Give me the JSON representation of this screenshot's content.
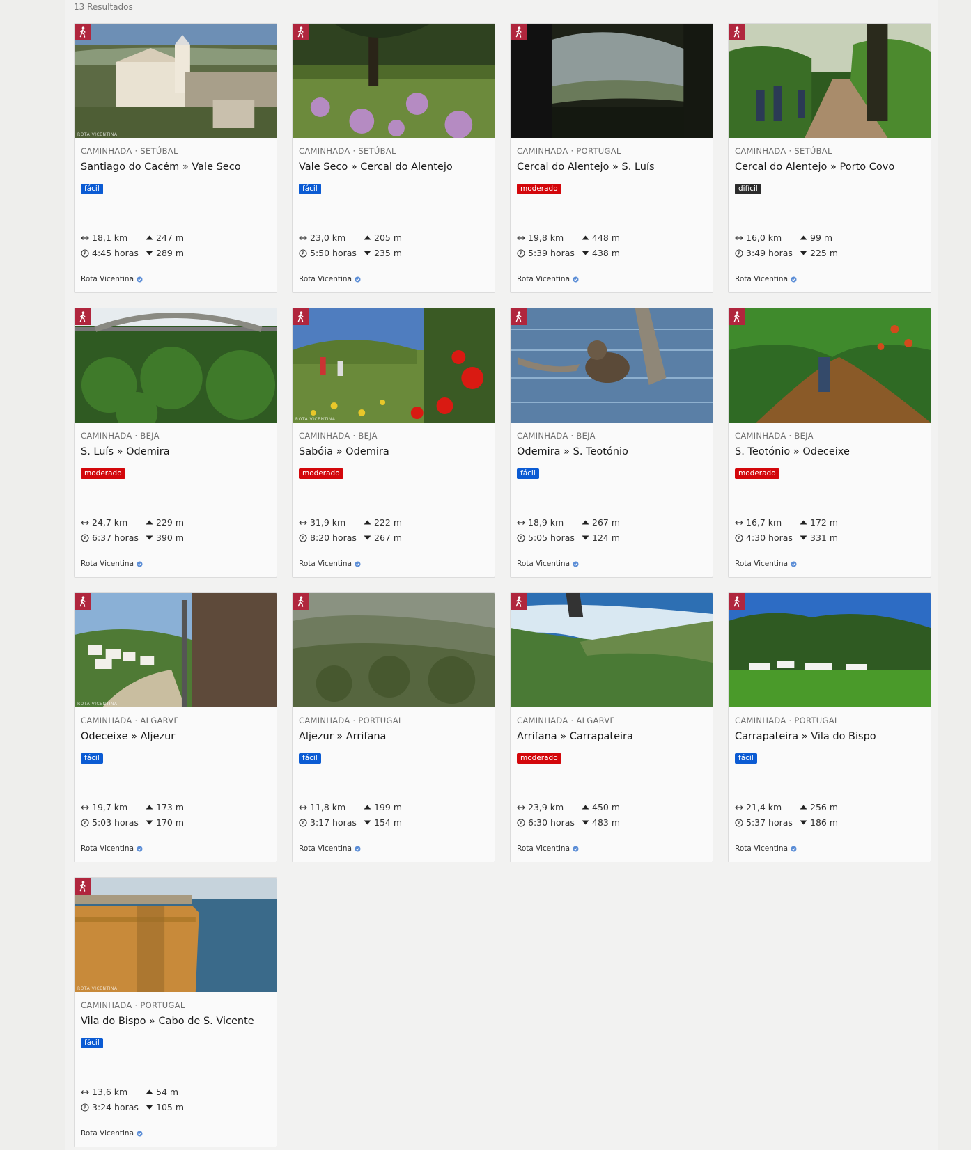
{
  "results": {
    "count_label": "13 Resultados"
  },
  "colors": {
    "badge": "#b0263d",
    "facil": "#0b5bd3",
    "moderado": "#d3070b",
    "dificil": "#2b2b2b"
  },
  "cards": [
    {
      "category": "CAMINHADA · SETÚBAL",
      "title": "Santiago do Cacém » Vale Seco",
      "difficulty": "fácil",
      "distance": "18,1 km",
      "duration": "4:45 horas",
      "ascent": "247 m",
      "descent": "289 m",
      "source": "Rota Vicentina",
      "scene": "village",
      "watermark": "ROTA VICENTINA"
    },
    {
      "category": "CAMINHADA · SETÚBAL",
      "title": "Vale Seco » Cercal do Alentejo",
      "difficulty": "fácil",
      "distance": "23,0 km",
      "duration": "5:50 horas",
      "ascent": "205 m",
      "descent": "235 m",
      "source": "Rota Vicentina",
      "scene": "meadow",
      "watermark": ""
    },
    {
      "category": "CAMINHADA · PORTUGAL",
      "title": "Cercal do Alentejo » S. Luís",
      "difficulty": "moderado",
      "distance": "19,8 km",
      "duration": "5:39 horas",
      "ascent": "448 m",
      "descent": "438 m",
      "source": "Rota Vicentina",
      "scene": "dark",
      "watermark": ""
    },
    {
      "category": "CAMINHADA · SETÚBAL",
      "title": "Cercal do Alentejo » Porto Covo",
      "difficulty": "difícil",
      "distance": "16,0 km",
      "duration": "3:49 horas",
      "ascent": "99 m",
      "descent": "225 m",
      "source": "Rota Vicentina",
      "scene": "forest",
      "watermark": ""
    },
    {
      "category": "CAMINHADA · BEJA",
      "title": "S. Luís » Odemira",
      "difficulty": "moderado",
      "distance": "24,7 km",
      "duration": "6:37 horas",
      "ascent": "229 m",
      "descent": "390 m",
      "source": "Rota Vicentina",
      "scene": "bridge",
      "watermark": ""
    },
    {
      "category": "CAMINHADA · BEJA",
      "title": "Sabóia » Odemira",
      "difficulty": "moderado",
      "distance": "31,9 km",
      "duration": "8:20 horas",
      "ascent": "222 m",
      "descent": "267 m",
      "source": "Rota Vicentina",
      "scene": "flowers",
      "watermark": "ROTA VICENTINA"
    },
    {
      "category": "CAMINHADA · BEJA",
      "title": "Odemira » S. Teotónio",
      "difficulty": "fácil",
      "distance": "18,9 km",
      "duration": "5:05 horas",
      "ascent": "267 m",
      "descent": "124 m",
      "source": "Rota Vicentina",
      "scene": "water",
      "watermark": ""
    },
    {
      "category": "CAMINHADA · BEJA",
      "title": "S. Teotónio » Odeceixe",
      "difficulty": "moderado",
      "distance": "16,7 km",
      "duration": "4:30 horas",
      "ascent": "172 m",
      "descent": "331 m",
      "source": "Rota Vicentina",
      "scene": "stream",
      "watermark": ""
    },
    {
      "category": "CAMINHADA · ALGARVE",
      "title": "Odeceixe » Aljezur",
      "difficulty": "fácil",
      "distance": "19,7 km",
      "duration": "5:03 horas",
      "ascent": "173 m",
      "descent": "170 m",
      "source": "Rota Vicentina",
      "scene": "hiker",
      "watermark": "ROTA VICENTINA"
    },
    {
      "category": "CAMINHADA · PORTUGAL",
      "title": "Aljezur » Arrifana",
      "difficulty": "fácil",
      "distance": "11,8 km",
      "duration": "3:17 horas",
      "ascent": "199 m",
      "descent": "154 m",
      "source": "Rota Vicentina",
      "scene": "misty",
      "watermark": ""
    },
    {
      "category": "CAMINHADA · ALGARVE",
      "title": "Arrifana » Carrapateira",
      "difficulty": "moderado",
      "distance": "23,9 km",
      "duration": "6:30 horas",
      "ascent": "450 m",
      "descent": "483 m",
      "source": "Rota Vicentina",
      "scene": "coast",
      "watermark": ""
    },
    {
      "category": "CAMINHADA · PORTUGAL",
      "title": "Carrapateira » Vila do Bispo",
      "difficulty": "fácil",
      "distance": "21,4 km",
      "duration": "5:37 horas",
      "ascent": "256 m",
      "descent": "186 m",
      "source": "Rota Vicentina",
      "scene": "hills",
      "watermark": ""
    },
    {
      "category": "CAMINHADA · PORTUGAL",
      "title": "Vila do Bispo » Cabo de S. Vicente",
      "difficulty": "fácil",
      "distance": "13,6 km",
      "duration": "3:24 horas",
      "ascent": "54 m",
      "descent": "105 m",
      "source": "Rota Vicentina",
      "scene": "cliff",
      "watermark": "ROTA VICENTINA"
    }
  ]
}
